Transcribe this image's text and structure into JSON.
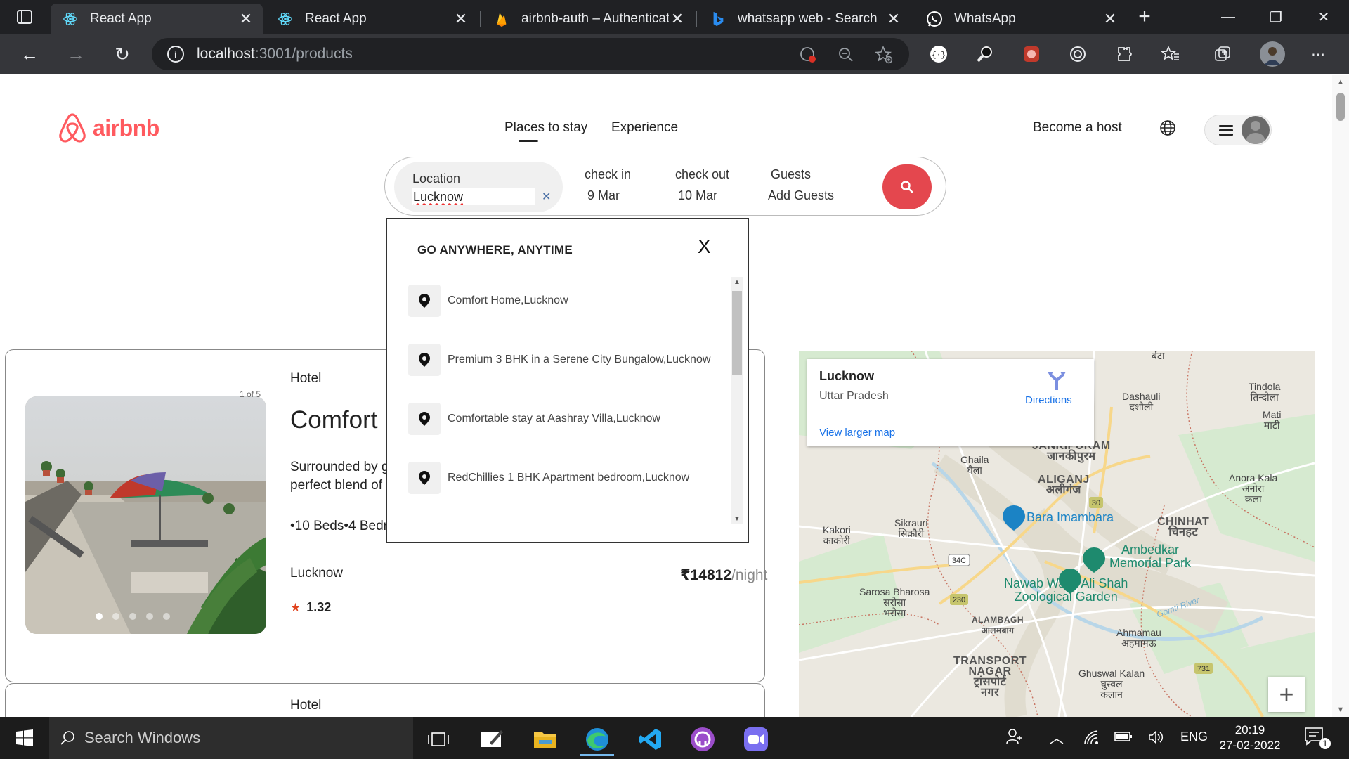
{
  "browser": {
    "tabs": [
      {
        "title": "React App",
        "icon": "react-icon",
        "active": true
      },
      {
        "title": "React App",
        "icon": "react-icon",
        "active": false
      },
      {
        "title": "airbnb-auth – Authenticati",
        "icon": "firebase-icon",
        "active": false
      },
      {
        "title": "whatsapp web - Search",
        "icon": "bing-icon",
        "active": false
      },
      {
        "title": "WhatsApp",
        "icon": "whatsapp-icon",
        "active": false
      }
    ],
    "url_host": "localhost",
    "url_rest": ":3001/products"
  },
  "header": {
    "logo_text": "airbnb",
    "nav": [
      "Places to stay",
      "Experience"
    ],
    "become_host": "Become a host"
  },
  "search": {
    "location_label": "Location",
    "location_value": "Lucknow",
    "checkin_label": "check in",
    "checkin_value": "9 Mar",
    "checkout_label": "check out",
    "checkout_value": "10 Mar",
    "guests_label": "Guests",
    "guests_value": "Add Guests"
  },
  "dropdown": {
    "title": "GO ANYWHERE, ANYTIME",
    "close": "X",
    "items": [
      "Comfort Home,Lucknow",
      "Premium 3 BHK in a Serene City Bungalow,Lucknow",
      "Comfortable stay at Aashray Villa,Lucknow",
      "RedChillies 1 BHK Apartment bedroom,Lucknow"
    ]
  },
  "listings": [
    {
      "type": "Hotel",
      "photo_count": "1 of 5",
      "title": "Comfort H",
      "desc_line1": "Surrounded by g",
      "desc_line2": "perfect blend of",
      "amenities": "•10 Beds•4 Bedr",
      "city": "Lucknow",
      "rating": "1.32",
      "price": "₹14812",
      "price_unit": "/night"
    },
    {
      "type": "Hotel"
    }
  ],
  "map": {
    "place_title": "Lucknow",
    "place_subtitle": "Uttar Pradesh",
    "directions": "Directions",
    "larger_map": "View larger map",
    "labels": {
      "bentaa": "बेंटा",
      "dashauli": "Dashauli",
      "dashauli_hi": "दशौली",
      "tindola": "Tindola",
      "tindola_hi": "तिन्दोला",
      "mati": "Mati",
      "mati_hi": "माटी",
      "ghaila": "Ghaila",
      "ghaila_hi": "घैला",
      "janakipuram": "JANKIPURAM",
      "janakipuram_hi": "जानकीपुरम",
      "aliganj": "ALIGANJ",
      "aliganj_hi": "अलीगंज",
      "anora": "Anora Kala",
      "anora_hi1": "अनोरा",
      "anora_hi2": "कला",
      "kakori": "Kakori",
      "kakori_hi": "काकोरी",
      "sikrauri": "Sikrauri",
      "sikrauri_hi": "सिक्रौरी",
      "bara": "Bara Imambara",
      "chinhat": "CHINHAT",
      "chinhat_hi": "चिनहट",
      "ambedkar1": "Ambedkar",
      "ambedkar2": "Memorial Park",
      "nawab1": "Nawab Wajid Ali Shah",
      "nawab2": "Zoological Garden",
      "sarosa": "Sarosa Bharosa",
      "sarosa_hi1": "सरोसा",
      "sarosa_hi2": "भरोसा",
      "alambagh": "ALAMBAGH",
      "alambagh_hi": "आलमबाग",
      "ahmamau": "Ahmamau",
      "ahmamau_hi": "अहमामऊ",
      "transport1": "TRANSPORT",
      "transport2": "NAGAR",
      "transport_hi1": "ट्रांसपोर्ट",
      "transport_hi2": "नगर",
      "ghuswal": "Ghuswal Kalan",
      "ghuswal_hi1": "घुस्वल",
      "ghuswal_hi2": "कलान",
      "gomti": "Gomti River",
      "r30": "30",
      "r34c": "34C",
      "r230": "230",
      "r731": "731"
    }
  },
  "taskbar": {
    "search_placeholder": "Search Windows",
    "lang": "ENG",
    "time": "20:19",
    "date": "27-02-2022",
    "notif_count": "1"
  }
}
